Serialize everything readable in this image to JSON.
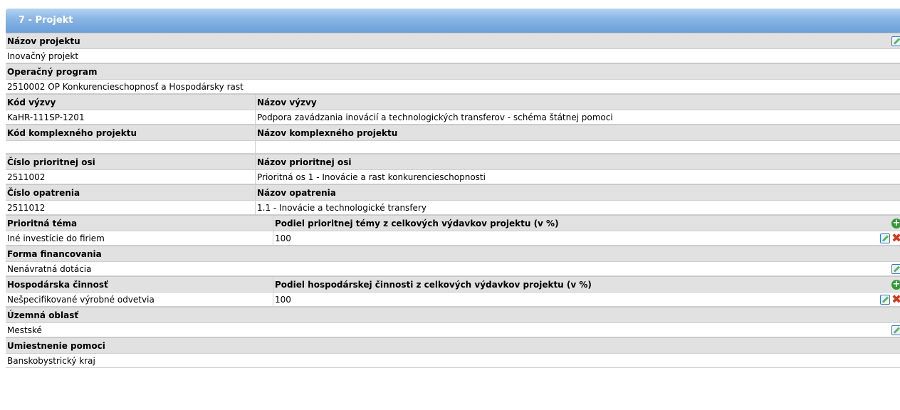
{
  "section": {
    "title": "7 - Projekt"
  },
  "nazov_projektu": {
    "label": "Názov projektu",
    "value": "Inovačný projekt"
  },
  "operacny_program": {
    "label": "Operačný program",
    "value": "2510002 OP Konkurencieschopnosť a Hospodársky rast"
  },
  "vyzva": {
    "kod_label": "Kód výzvy",
    "nazov_label": "Názov výzvy",
    "kod": "KaHR-111SP-1201",
    "nazov": "Podpora zavádzania inovácií a technologických transferov - schéma štátnej pomoci"
  },
  "komplexny": {
    "kod_label": "Kód komplexného projektu",
    "nazov_label": "Názov komplexného projektu",
    "kod": "",
    "nazov": ""
  },
  "prioritna_os": {
    "cislo_label": "Číslo prioritnej osi",
    "nazov_label": "Názov prioritnej osi",
    "cislo": "2511002",
    "nazov": "Prioritná os 1 - Inovácie a rast konkurencieschopnosti"
  },
  "opatrenie": {
    "cislo_label": "Číslo opatrenia",
    "nazov_label": "Názov opatrenia",
    "cislo": "2511012",
    "nazov": "1.1 - Inovácie a technologické transfery"
  },
  "prioritna_tema": {
    "label": "Prioritná téma",
    "podiel_label": "Podiel prioritnej témy z celkových výdavkov projektu (v %)",
    "value": "Iné investície do firiem",
    "podiel": "100"
  },
  "forma": {
    "label": "Forma financovania",
    "value": "Nenávratná dotácia"
  },
  "hospodarska": {
    "label": "Hospodárska činnosť",
    "podiel_label": "Podiel hospodárskej činnosti z celkových výdavkov projektu (v %)",
    "value": "Nešpecifikované výrobné odvetvia",
    "podiel": "100"
  },
  "uzemna": {
    "label": "Územná oblasť",
    "value": "Mestské"
  },
  "umiestnenie": {
    "label": "Umiestnenie pomoci",
    "value": "Banskobystrický kraj"
  },
  "icons": {
    "add": "+",
    "delete": "✖"
  }
}
